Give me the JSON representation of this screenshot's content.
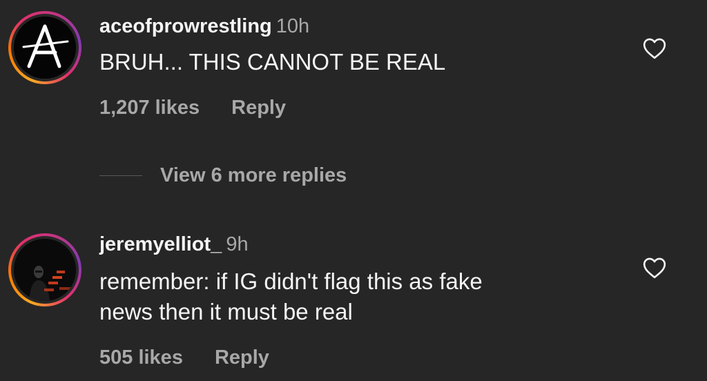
{
  "comments": [
    {
      "username": "aceofprowrestling",
      "time": "10h",
      "text_lines": [
        "BRUH... THIS CANNOT BE REAL"
      ],
      "likes": "1,207 likes",
      "reply_label": "Reply",
      "avatar_letter": "A"
    },
    {
      "username": "jeremyelliot_",
      "time": "9h",
      "text_lines": [
        "remember: if IG didn't flag this as fake",
        "news then it must be real"
      ],
      "likes": "505 likes",
      "reply_label": "Reply"
    }
  ],
  "view_more_label": "View 6 more replies",
  "colors": {
    "background": "#262626",
    "primary_text": "#f5f5f5",
    "secondary_text": "#a8a8a8",
    "story_ring": [
      "#f9a825",
      "#e1306c",
      "#833ab4"
    ]
  },
  "icons": {
    "like": "heart-outline-icon"
  }
}
